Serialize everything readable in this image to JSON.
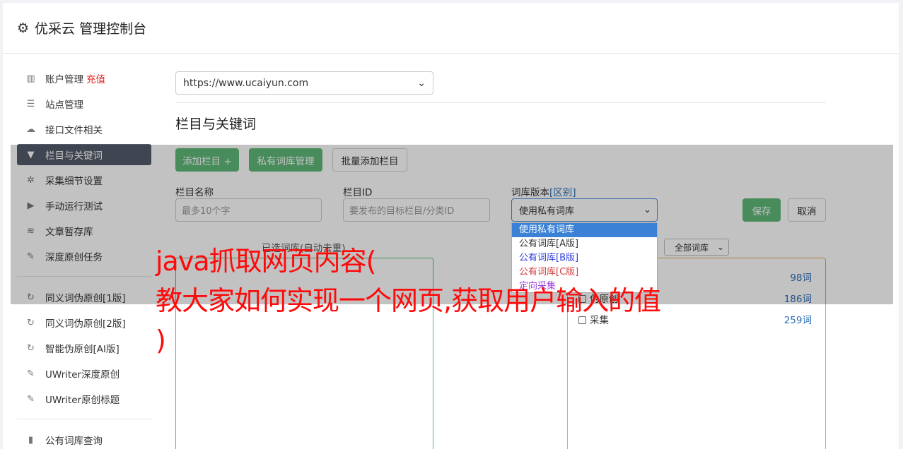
{
  "header": {
    "title": "优采云 管理控制台"
  },
  "sidebar": {
    "items": [
      {
        "label": "账户管理",
        "badge": "充值",
        "icon": "bar-chart-icon"
      },
      {
        "label": "站点管理",
        "icon": "server-icon"
      },
      {
        "label": "接口文件相关",
        "icon": "cloud-upload-icon"
      },
      {
        "label": "栏目与关键词",
        "icon": "filter-icon",
        "active": true
      },
      {
        "label": "采集细节设置",
        "icon": "cogs-icon"
      },
      {
        "label": "手动运行测试",
        "icon": "play-circle-icon"
      },
      {
        "label": "文章暂存库",
        "icon": "database-icon"
      },
      {
        "label": "深度原创任务",
        "icon": "edit-icon"
      },
      {
        "label": "同义词伪原创[1版]",
        "icon": "refresh-icon"
      },
      {
        "label": "同义词伪原创[2版]",
        "icon": "refresh-icon"
      },
      {
        "label": "智能伪原创[AI版]",
        "icon": "refresh-icon"
      },
      {
        "label": "UWriter深度原创",
        "icon": "edit-icon"
      },
      {
        "label": "UWriter原创标题",
        "icon": "edit-icon"
      },
      {
        "label": "公有词库查询",
        "icon": "book-icon"
      }
    ]
  },
  "main": {
    "site_select": "https://www.ucaiyun.com",
    "section_title": "栏目与关键词",
    "buttons": {
      "add_column": "添加栏目 +",
      "private_lib": "私有词库管理",
      "batch_add": "批量添加栏目",
      "save": "保存",
      "cancel": "取消"
    },
    "fields": {
      "column_name_label": "栏目名称",
      "column_name_placeholder": "最多10个字",
      "column_id_label": "栏目ID",
      "column_id_placeholder": "要发布的目标栏目/分类ID",
      "lib_version_label": "词库版本",
      "lib_version_link": "[区别]",
      "lib_version_value": "使用私有词库"
    },
    "dropdown_options": [
      "使用私有词库",
      "公有词库[A版]",
      "公有词库[B版]",
      "公有词库[C版]",
      "定向采集"
    ],
    "selected_label": "已选词库(自动去重)",
    "filter_select": "全部词库",
    "libraries": [
      {
        "name": "",
        "count": "98词"
      },
      {
        "name": "伪原创",
        "count": "186词"
      },
      {
        "name": "采集",
        "count": "259词"
      }
    ]
  },
  "watermark": {
    "line1": "java抓取网页内容(",
    "line2": "教大家如何实现一个网页,获取用户输入的值",
    "line3": ")"
  }
}
